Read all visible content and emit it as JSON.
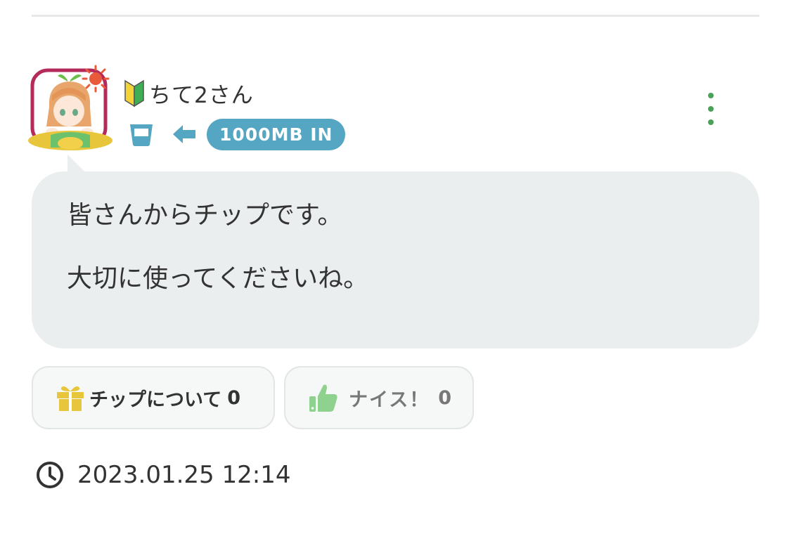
{
  "post": {
    "user": {
      "name": "ちて2さん",
      "badge_icon": "beginner-mark-icon",
      "avatar": "anime-girl-avatar"
    },
    "status": {
      "cup_icon": "cup-icon",
      "direction_icon": "arrow-left-icon",
      "data_badge": "1000MB IN"
    },
    "menu_icon": "kebab-menu-icon",
    "message": {
      "line1": "皆さんからチップです。",
      "line2": "大切に使ってくださいね。"
    },
    "actions": {
      "tip": {
        "label": "チップについて",
        "count": "0",
        "icon": "gift-icon"
      },
      "nice": {
        "label": "ナイス！",
        "count": "0",
        "icon": "thumbs-up-icon"
      }
    },
    "timestamp": "2023.01.25 12:14",
    "timestamp_icon": "clock-icon"
  },
  "colors": {
    "accent_green": "#4aa25a",
    "pill_blue": "#55a6c2",
    "bubble_bg": "#eaeeee",
    "gift_yellow": "#e8c63c",
    "thumb_green": "#8fd18f"
  }
}
